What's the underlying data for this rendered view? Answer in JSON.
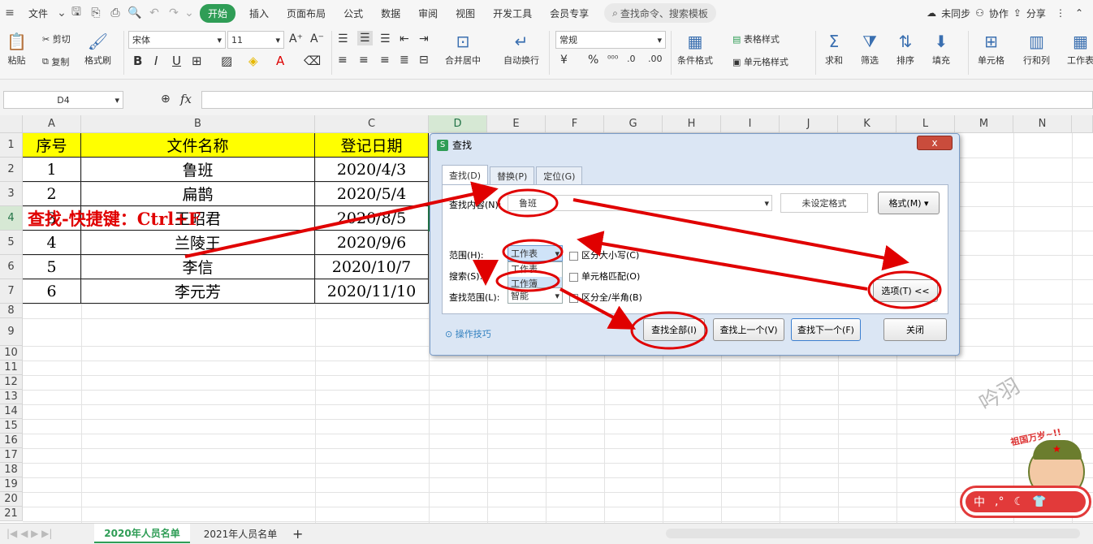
{
  "menubar": {
    "file": "文件",
    "tabs": [
      "开始",
      "插入",
      "页面布局",
      "公式",
      "数据",
      "审阅",
      "视图",
      "开发工具",
      "会员专享"
    ],
    "active_tab": "开始",
    "search": "查找命令、搜索模板",
    "sync": "未同步",
    "collab": "协作",
    "share": "分享"
  },
  "ribbon": {
    "paste": "粘贴",
    "cut": "剪切",
    "copy": "复制",
    "format_painter": "格式刷",
    "font_name": "宋体",
    "font_size": "11",
    "merge": "合并居中",
    "wrap": "自动换行",
    "number_format": "常规",
    "cond_format": "条件格式",
    "table_style": "表格样式",
    "cell_style": "单元格样式",
    "sum": "求和",
    "filter": "筛选",
    "sort": "排序",
    "fill": "填充",
    "cells": "单元格",
    "rowcol": "行和列",
    "worksheet": "工作表"
  },
  "formula_bar": {
    "namebox": "D4",
    "fx": "fx"
  },
  "columns": [
    "A",
    "B",
    "C",
    "D",
    "E",
    "F",
    "G",
    "H",
    "I",
    "J",
    "K",
    "L",
    "M",
    "N"
  ],
  "rows": [
    "1",
    "2",
    "3",
    "4",
    "5",
    "6",
    "7",
    "8",
    "9",
    "10",
    "11",
    "12",
    "13",
    "14",
    "15",
    "16",
    "17",
    "18",
    "19",
    "20",
    "21"
  ],
  "table": {
    "headers": [
      "序号",
      "文件名称",
      "登记日期"
    ],
    "rows": [
      [
        "1",
        "鲁班",
        "2020/4/3"
      ],
      [
        "2",
        "扁鹊",
        "2020/5/4"
      ],
      [
        "3",
        "王昭君",
        "2020/8/5"
      ],
      [
        "4",
        "兰陵王",
        "2020/9/6"
      ],
      [
        "5",
        "李信",
        "2020/10/7"
      ],
      [
        "6",
        "李元芳",
        "2020/11/10"
      ]
    ]
  },
  "note": "查找-快捷键：Ctrl+F",
  "sheets": [
    "2020年人员名单",
    "2021年人员名单"
  ],
  "dialog": {
    "title": "查找",
    "close": "x",
    "tabs": [
      "查找(D)",
      "替换(P)",
      "定位(G)"
    ],
    "find_label": "查找内容(N):",
    "find_value": "鲁班",
    "format_status": "未设定格式",
    "format_btn": "格式(M)",
    "scope_label": "范围(H):",
    "scope_value": "工作表",
    "scope_options": [
      "工作表",
      "工作簿"
    ],
    "search_label": "搜索(S):",
    "lookin_label": "查找范围(L):",
    "lookin_value": "智能",
    "match_case": "区分大小写(C)",
    "match_cell": "单元格匹配(O)",
    "match_width": "区分全/半角(B)",
    "options_btn": "选项(T) <<",
    "tips": "操作技巧",
    "find_all": "查找全部(I)",
    "find_prev": "查找上一个(V)",
    "find_next": "查找下一个(F)",
    "close_btn": "关闭"
  },
  "watermark": "吟羽",
  "sticker": "祖国万岁~!!",
  "ime": "中",
  "colors": {
    "accent": "#2f9d56",
    "annotation": "#e00000",
    "header_fill": "#ffff00"
  }
}
